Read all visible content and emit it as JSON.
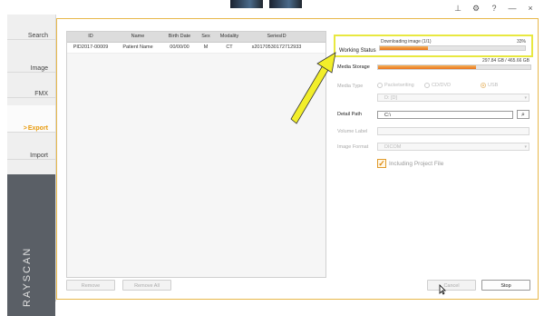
{
  "sidebar": {
    "items": [
      {
        "label": "Search"
      },
      {
        "label": "Image"
      },
      {
        "label": "FMX"
      },
      {
        "label": "Export",
        "marker": ">"
      },
      {
        "label": "Import"
      }
    ],
    "brand": "RAYSCAN"
  },
  "table": {
    "columns": [
      "ID",
      "Name",
      "Birth Date",
      "Sex",
      "Modality",
      "SeriesID"
    ],
    "rows": [
      [
        "PID2017-00009",
        "Patient Name",
        "00/00/00",
        "M",
        "CT",
        "s20170530172712933"
      ]
    ]
  },
  "buttons": {
    "remove": "Remove",
    "remove_all": "Remove All",
    "cancel": "Cancel",
    "stop": "Stop"
  },
  "working_status": {
    "label": "Working Status",
    "text": "Downloading image (1/1)",
    "percent_text": "33%",
    "progress": 0.33
  },
  "media_storage": {
    "label": "Media Storage",
    "usage": "297.84 GB / 465.66 GB",
    "fraction": 0.64
  },
  "media_type": {
    "label": "Media Type",
    "options": [
      "Packetwriting",
      "CD/DVD",
      "USB"
    ],
    "selected": "USB",
    "drive": "D: [D]"
  },
  "detail_path": {
    "label": "Detail Path",
    "value": "C:\\"
  },
  "volume_label": {
    "label": "Volume Label",
    "value": ""
  },
  "image_format": {
    "label": "Image Format",
    "value": "DICOM"
  },
  "include_project": {
    "label": "Including Project File",
    "checked": true
  },
  "colors": {
    "accent": "#e89a0c",
    "highlight": "#e8e840",
    "progress": "#e8721a"
  }
}
